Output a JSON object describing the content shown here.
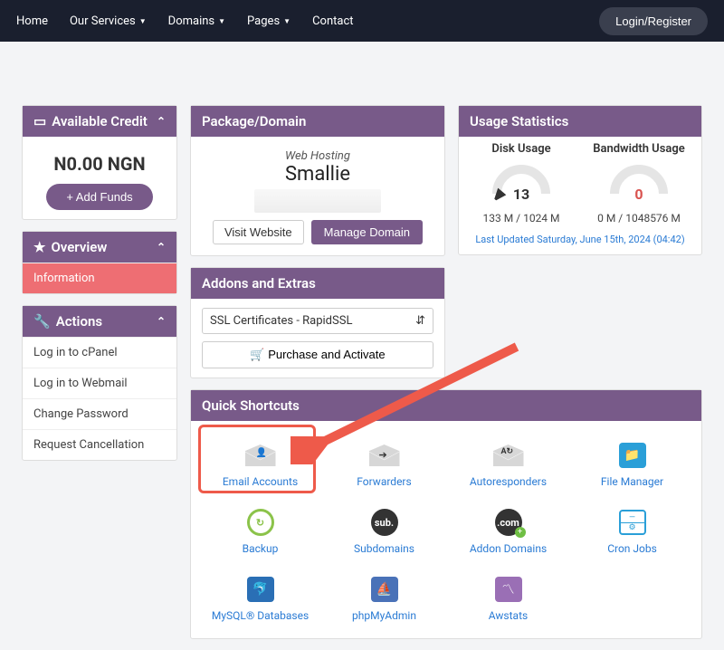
{
  "nav": {
    "home": "Home",
    "services": "Our Services",
    "domains": "Domains",
    "pages": "Pages",
    "contact": "Contact",
    "login": "Login/Register"
  },
  "credit": {
    "title": "Available Credit",
    "balance": "N0.00 NGN",
    "add_funds": "+ Add Funds"
  },
  "overview": {
    "title": "Overview",
    "information": "Information"
  },
  "actions": {
    "title": "Actions",
    "items": [
      "Log in to cPanel",
      "Log in to Webmail",
      "Change Password",
      "Request Cancellation"
    ]
  },
  "package": {
    "title": "Package/Domain",
    "type": "Web Hosting",
    "name": "Smallie",
    "visit": "Visit Website",
    "manage": "Manage Domain"
  },
  "addons": {
    "title": "Addons and Extras",
    "selected": "SSL Certificates - RapidSSL",
    "purchase": "🛒 Purchase and Activate"
  },
  "usage": {
    "title": "Usage Statistics",
    "disk_title": "Disk Usage",
    "disk_value": "13",
    "disk_sub": "133 M / 1024 M",
    "bw_title": "Bandwidth Usage",
    "bw_value": "0",
    "bw_sub": "0 M / 1048576 M",
    "updated": "Last Updated Saturday, June 15th, 2024 (04:42)"
  },
  "shortcuts": {
    "title": "Quick Shortcuts",
    "items": [
      {
        "label": "Email Accounts",
        "icon": "envelope-user"
      },
      {
        "label": "Forwarders",
        "icon": "envelope-arrow"
      },
      {
        "label": "Autoresponders",
        "icon": "envelope-aa"
      },
      {
        "label": "File Manager",
        "icon": "folder-blue"
      },
      {
        "label": "Backup",
        "icon": "refresh-green"
      },
      {
        "label": "Subdomains",
        "icon": "sub-circle"
      },
      {
        "label": "Addon Domains",
        "icon": "com-circle"
      },
      {
        "label": "Cron Jobs",
        "icon": "calendar"
      },
      {
        "label": "MySQL® Databases",
        "icon": "db-blue"
      },
      {
        "label": "phpMyAdmin",
        "icon": "pma-blue"
      },
      {
        "label": "Awstats",
        "icon": "stats-purple"
      }
    ]
  }
}
